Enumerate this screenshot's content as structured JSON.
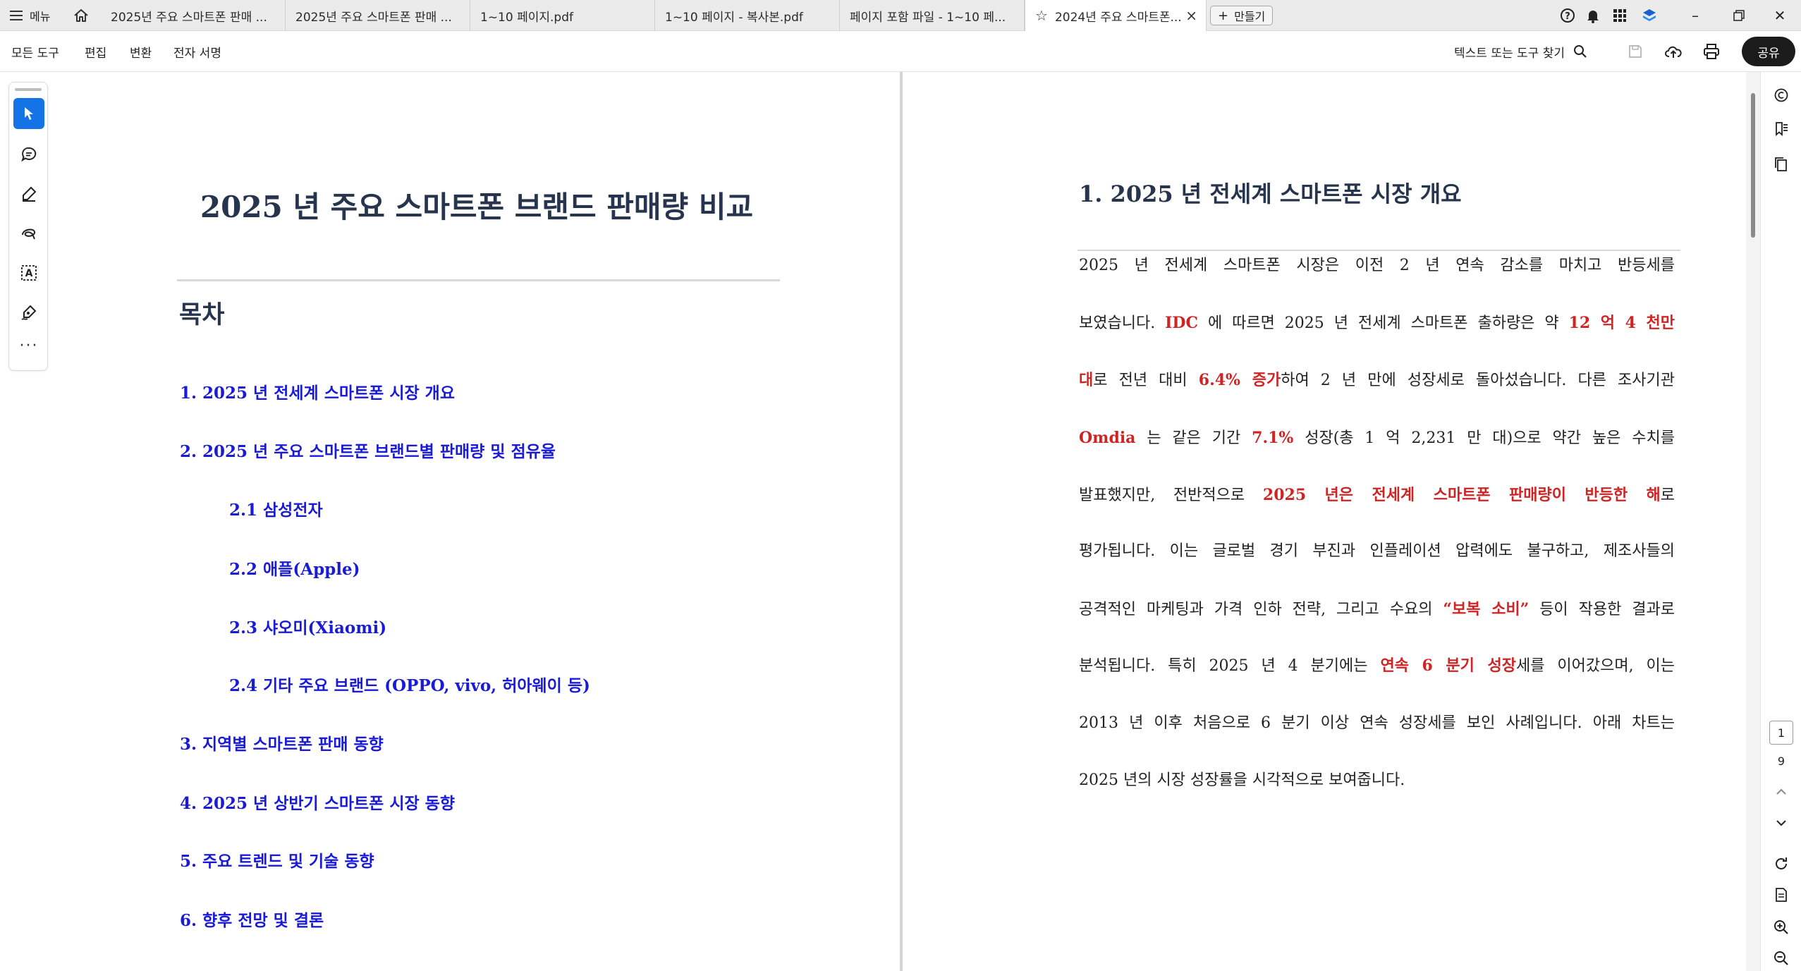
{
  "tabbar": {
    "menu_label": "메뉴",
    "tabs": [
      {
        "label": "2025년 주요 스마트폰 판매 ..."
      },
      {
        "label": "2025년 주요 스마트폰 판매 ..."
      },
      {
        "label": "1~10 페이지.pdf"
      },
      {
        "label": "1~10 페이지 - 복사본.pdf"
      },
      {
        "label": "페이지 포함 파일 - 1~10 페..."
      },
      {
        "label": "2024년 주요 스마트폰..."
      }
    ],
    "new_tab_label": "만들기"
  },
  "toolbar": {
    "menus": [
      "모든 도구",
      "편집",
      "변환",
      "전자 서명"
    ],
    "search_label": "텍스트 또는 도구 찾기",
    "share_label": "공유"
  },
  "left_page": {
    "title": "2025 년 주요 스마트폰 브랜드 판매량 비교",
    "toc_heading": "목차",
    "toc": [
      "1. 2025 년 전세계 스마트폰 시장 개요",
      "2. 2025 년 주요 스마트폰 브랜드별 판매량 및 점유율",
      "2.1 삼성전자",
      "2.2 애플(Apple)",
      "2.3 샤오미(Xiaomi)",
      "2.4 기타 주요 브랜드 (OPPO, vivo, 허아웨이 등)",
      "3. 지역별 스마트폰 판매 동향",
      "4. 2025 년 상반기 스마트폰 시장 동향",
      "5. 주요 트렌드 및 기술 동향",
      "6. 향후 전망 및 결론"
    ]
  },
  "right_page": {
    "section_title": "1. 2025 년 전세계 스마트폰 시장 개요",
    "lines": [
      [
        {
          "t": "2025 년 전세계 스마트폰 시장은 이전 2 년 연속 감소를 마치고 반등세를"
        }
      ],
      [
        {
          "t": "보였습니다. "
        },
        {
          "t": "IDC",
          "h": true
        },
        {
          "t": " 에 따르면 2025 년 전세계 스마트폰 출하량은 약 "
        },
        {
          "t": "12 억 4 천만",
          "h": true
        }
      ],
      [
        {
          "t": "대",
          "h": true
        },
        {
          "t": "로 전년 대비 "
        },
        {
          "t": "6.4% 증가",
          "h": true
        },
        {
          "t": "하여 2 년 만에 성장세로 돌아섰습니다. 다른 조사기관"
        }
      ],
      [
        {
          "t": "Omdia",
          "h": true
        },
        {
          "t": " 는 같은 기간 "
        },
        {
          "t": "7.1%",
          "h": true
        },
        {
          "t": " 성장(총 1 억 2,231 만 대)으로 약간 높은 수치를"
        }
      ],
      [
        {
          "t": "발표했지만, 전반적으로 "
        },
        {
          "t": "2025 년은 전세계 스마트폰 판매량이 반등한 해",
          "h": true
        },
        {
          "t": "로"
        }
      ],
      [
        {
          "t": "평가됩니다. 이는 글로벌 경기 부진과 인플레이션 압력에도 불구하고, 제조사들의"
        }
      ],
      [
        {
          "t": "공격적인 마케팅과 가격 인하 전략, 그리고 수요의 "
        },
        {
          "t": "“보복 소비”",
          "h": true
        },
        {
          "t": " 등이 작용한 결과로"
        }
      ],
      [
        {
          "t": "분석됩니다. 특히 2025 년 4 분기에는 "
        },
        {
          "t": "연속 6 분기 성장",
          "h": true
        },
        {
          "t": "세를 이어갔으며, 이는"
        }
      ],
      [
        {
          "t": "2013 년 이후 처음으로 6 분기 이상 연속 성장세를 보인 사례입니다. 아래 차트는"
        }
      ],
      [
        {
          "t": "2025 년의 시장 성장률을 시각적으로 보여줍니다."
        }
      ]
    ]
  },
  "pagination": {
    "current": "1",
    "total": "9"
  },
  "colors": {
    "accent": "#1473e6",
    "link": "#1a1bd6",
    "highlight": "#cf2424",
    "heading": "#26354d"
  }
}
